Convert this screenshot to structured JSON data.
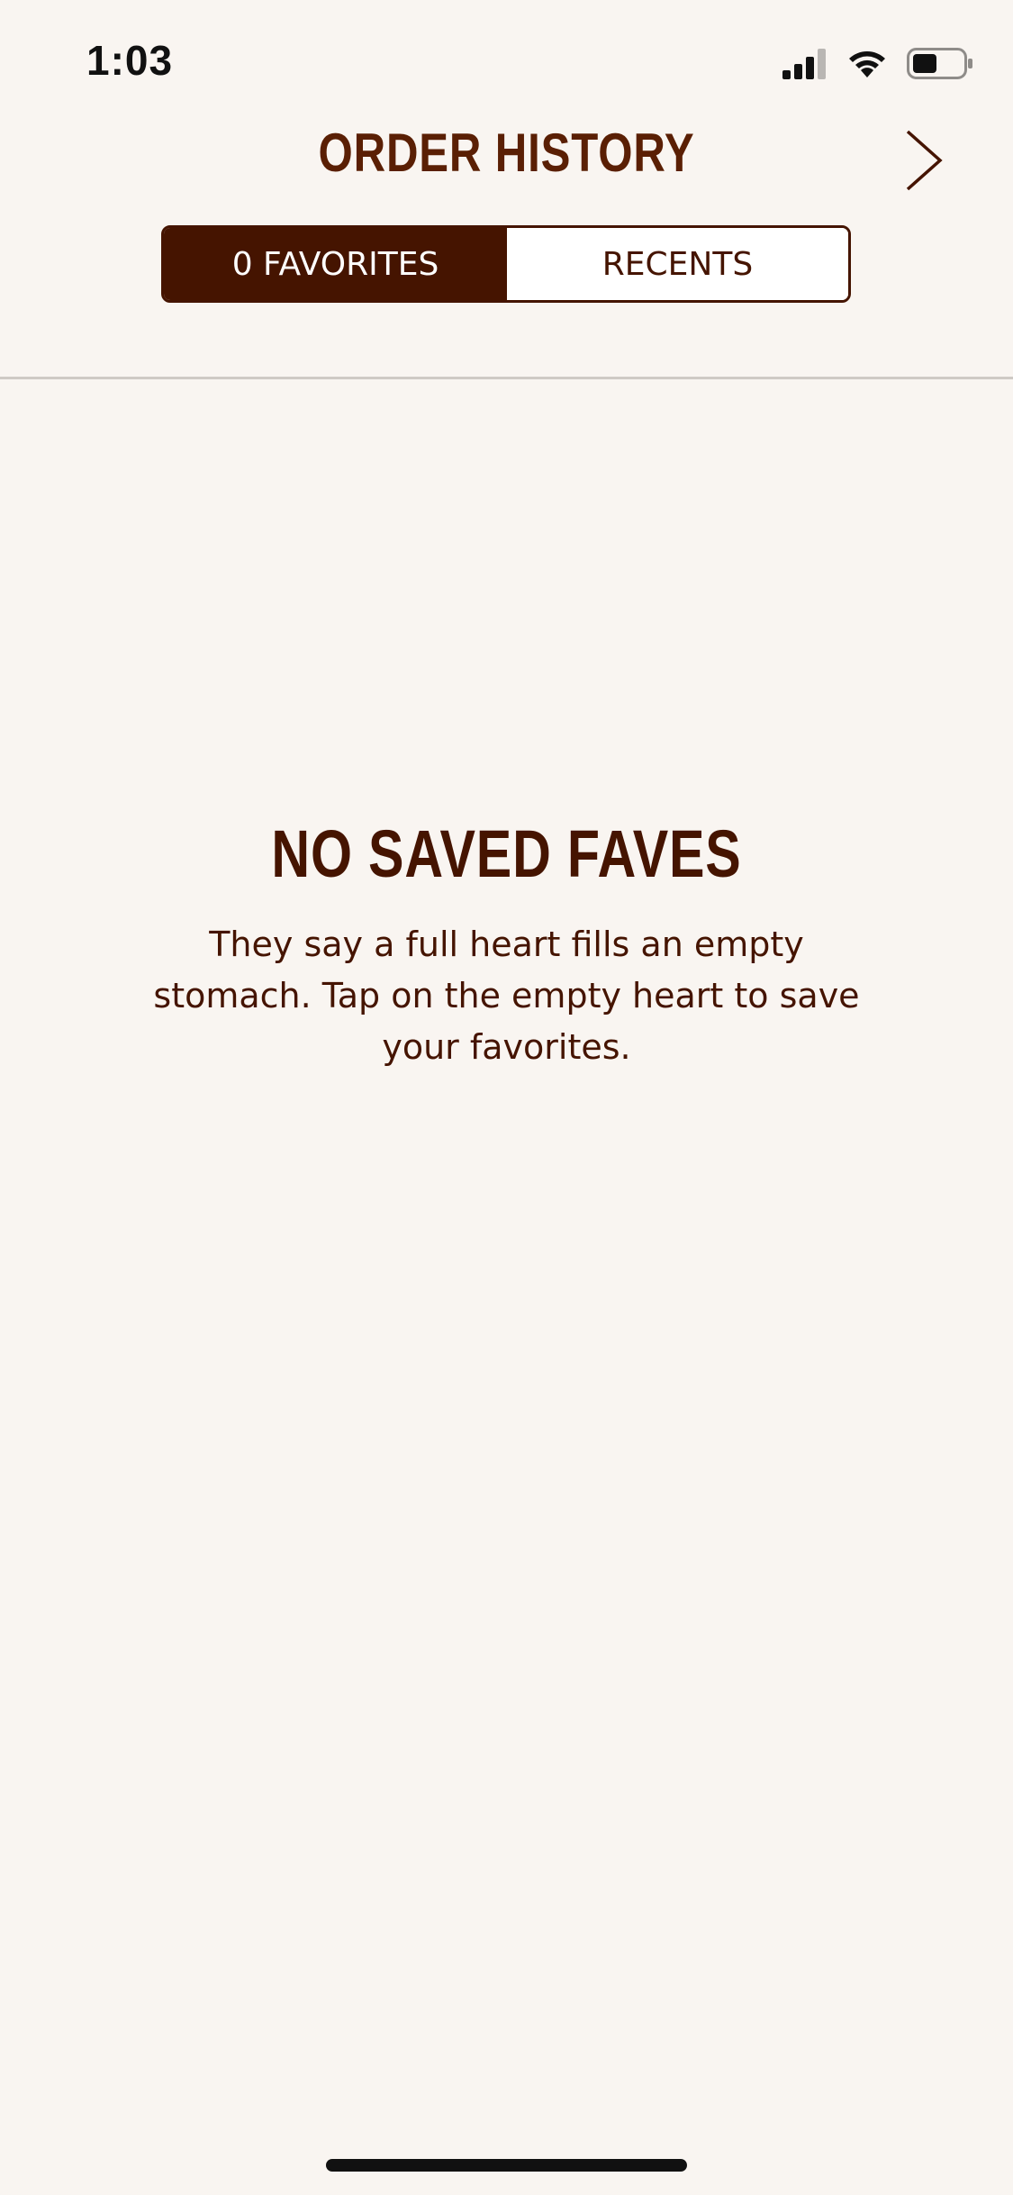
{
  "status_bar": {
    "time": "1:03",
    "icons": [
      "signal-icon",
      "wifi-icon",
      "battery-icon"
    ]
  },
  "header": {
    "title": "ORDER HISTORY",
    "next_icon": "chevron-right-icon"
  },
  "segments": {
    "favorites_label": "0 FAVORITES",
    "recents_label": "RECENTS",
    "selected": "favorites"
  },
  "empty_state": {
    "title": "NO SAVED FAVES",
    "message": "They say a full heart fills an empty stomach. Tap on the empty heart to save your favorites."
  },
  "colors": {
    "background": "#f9f5f1",
    "brand_brown": "#451400",
    "divider": "#cfcac5"
  }
}
